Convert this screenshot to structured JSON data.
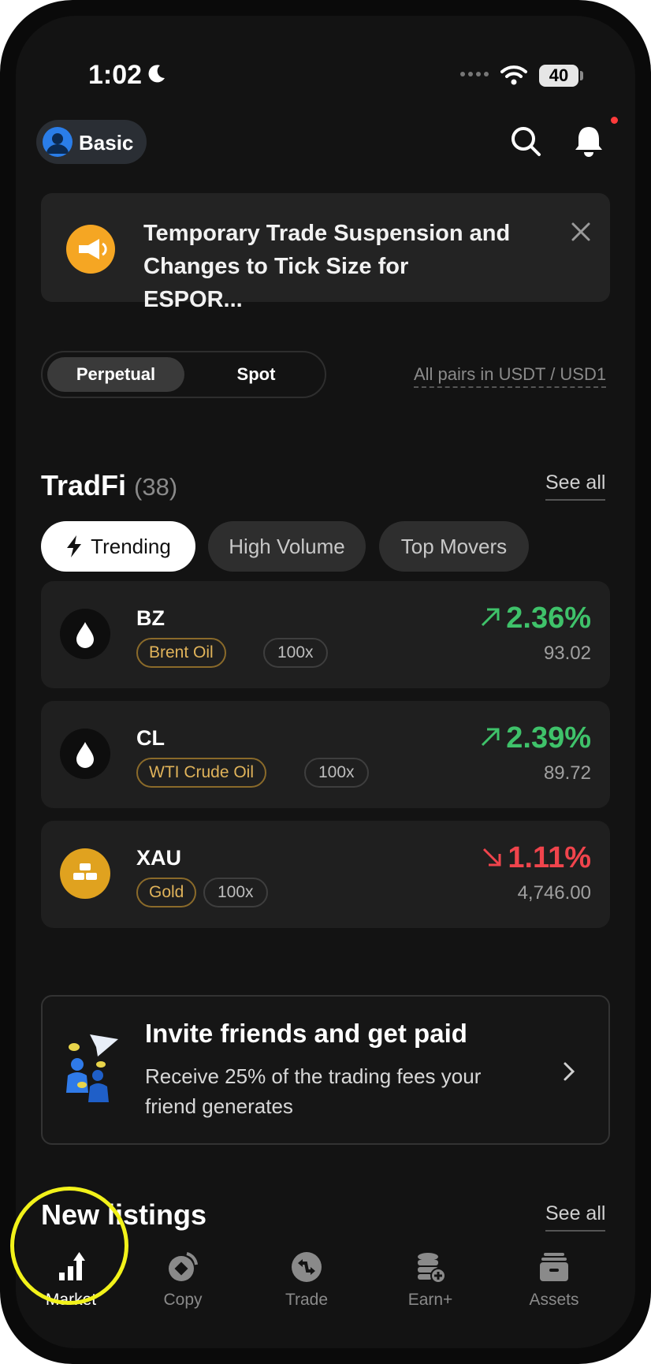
{
  "status_bar": {
    "time": "1:02",
    "battery": "40"
  },
  "header": {
    "account_label": "Basic"
  },
  "banner": {
    "text": "Temporary Trade Suspension and Changes to Tick Size for ESPOR..."
  },
  "market_toggle": {
    "perpetual": "Perpetual",
    "spot": "Spot",
    "active": "Perpetual",
    "pairs_note": "All pairs in USDT / USD1"
  },
  "tradfi": {
    "title": "TradFi",
    "count": "(38)",
    "see_all": "See all",
    "filters": [
      "Trending",
      "High Volume",
      "Top Movers"
    ],
    "active_filter": "Trending",
    "items": [
      {
        "symbol": "BZ",
        "name": "Brent Oil",
        "leverage": "100x",
        "change": "2.36%",
        "direction": "up",
        "price": "93.02",
        "icon": "oil-drop-icon"
      },
      {
        "symbol": "CL",
        "name": "WTI Crude Oil",
        "leverage": "100x",
        "change": "2.39%",
        "direction": "up",
        "price": "89.72",
        "icon": "oil-drop-icon"
      },
      {
        "symbol": "XAU",
        "name": "Gold",
        "leverage": "100x",
        "change": "1.11%",
        "direction": "down",
        "price": "4,746.00",
        "icon": "gold-bars-icon"
      }
    ]
  },
  "invite": {
    "title": "Invite friends and get paid",
    "subtitle": "Receive 25% of the trading fees your friend generates"
  },
  "new_listings": {
    "title": "New listings",
    "see_all": "See all"
  },
  "tabs": [
    {
      "label": "Market",
      "icon": "market-icon",
      "active": true
    },
    {
      "label": "Copy",
      "icon": "copy-icon",
      "active": false
    },
    {
      "label": "Trade",
      "icon": "trade-icon",
      "active": false
    },
    {
      "label": "Earn+",
      "icon": "earn-icon",
      "active": false
    },
    {
      "label": "Assets",
      "icon": "assets-icon",
      "active": false
    }
  ],
  "colors": {
    "up": "#3fc26a",
    "down": "#f0444c",
    "tag_gold": "#e0b35a",
    "highlight": "#f2f21a"
  }
}
